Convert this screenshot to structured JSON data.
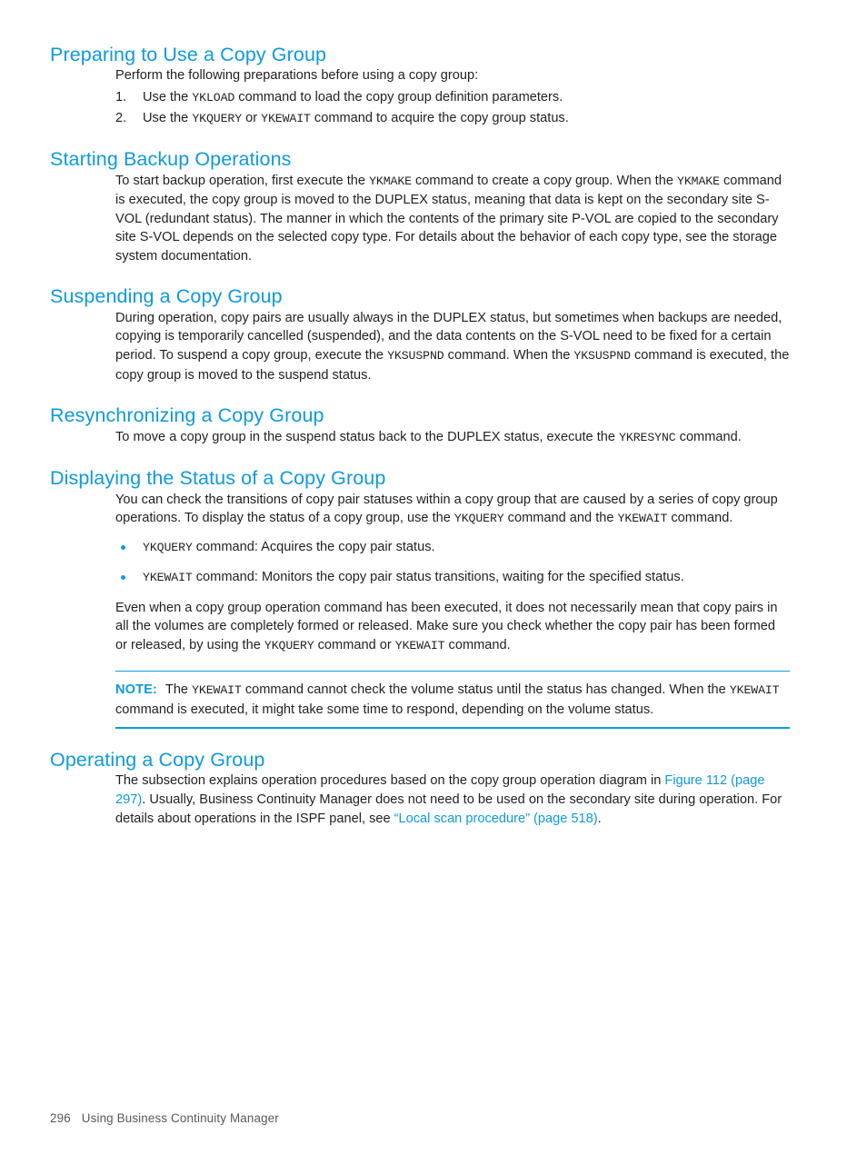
{
  "page": {
    "number": "296",
    "running_title": "Using Business Continuity Manager",
    "accent_color": "#0e9ade",
    "text_color": "#231f20",
    "footer_color": "#58595b"
  },
  "sections": [
    {
      "id": "preparing",
      "heading": "Preparing to Use a Copy Group",
      "intro": "Perform the following preparations before using a copy group:",
      "list": [
        {
          "number": "1.",
          "parts": [
            {
              "t": "text",
              "v": "Use the "
            },
            {
              "t": "code",
              "v": "YKLOAD"
            },
            {
              "t": "text",
              "v": " command to load the copy group definition parameters."
            }
          ]
        },
        {
          "number": "2.",
          "parts": [
            {
              "t": "text",
              "v": "Use the "
            },
            {
              "t": "code",
              "v": "YKQUERY"
            },
            {
              "t": "text",
              "v": " or "
            },
            {
              "t": "code",
              "v": "YKEWAIT"
            },
            {
              "t": "text",
              "v": " command to acquire the copy group status."
            }
          ]
        }
      ]
    },
    {
      "id": "starting-backup",
      "heading": "Starting Backup Operations",
      "paragraph_parts": [
        {
          "t": "text",
          "v": "To start backup operation, first execute the "
        },
        {
          "t": "code",
          "v": "YKMAKE"
        },
        {
          "t": "text",
          "v": " command to create a copy group. When the "
        },
        {
          "t": "code",
          "v": "YKMAKE"
        },
        {
          "t": "text",
          "v": " command is executed, the copy group is moved to the DUPLEX status, meaning that data is kept on the secondary site S-VOL (redundant status). The manner in which the contents of the primary site P-VOL are copied to the secondary site S-VOL depends on the selected copy type. For details about the behavior of each copy type, see the storage system documentation."
        }
      ]
    },
    {
      "id": "suspending",
      "heading": "Suspending a Copy Group",
      "paragraph_parts": [
        {
          "t": "text",
          "v": "During operation, copy pairs are usually always in the DUPLEX status, but sometimes when backups are needed, copying is temporarily cancelled (suspended), and the data contents on the S-VOL need to be fixed for a certain period. To suspend a copy group, execute the "
        },
        {
          "t": "code",
          "v": "YKSUSPND"
        },
        {
          "t": "text",
          "v": " command. When the "
        },
        {
          "t": "code",
          "v": "YKSUSPND"
        },
        {
          "t": "text",
          "v": " command is executed, the copy group is moved to the suspend status."
        }
      ]
    },
    {
      "id": "resynchronizing",
      "heading": "Resynchronizing a Copy Group",
      "paragraph_parts": [
        {
          "t": "text",
          "v": "To move a copy group in the suspend status back to the DUPLEX status, execute the "
        },
        {
          "t": "code",
          "v": "YKRESYNC"
        },
        {
          "t": "text",
          "v": " command."
        }
      ]
    },
    {
      "id": "displaying-status",
      "heading": "Displaying the Status of a Copy Group",
      "paragraph_parts": [
        {
          "t": "text",
          "v": "You can check the transitions of copy pair statuses within a copy group that are caused by a series of copy group operations. To display the status of a copy group, use the "
        },
        {
          "t": "code",
          "v": "YKQUERY"
        },
        {
          "t": "text",
          "v": " command and the "
        },
        {
          "t": "code",
          "v": "YKEWAIT"
        },
        {
          "t": "text",
          "v": " command."
        }
      ],
      "bullets": [
        [
          {
            "t": "code",
            "v": "YKQUERY"
          },
          {
            "t": "text",
            "v": " command: Acquires the copy pair status."
          }
        ],
        [
          {
            "t": "code",
            "v": "YKEWAIT"
          },
          {
            "t": "text",
            "v": " command: Monitors the copy pair status transitions, waiting for the specified status."
          }
        ]
      ],
      "paragraph2_parts": [
        {
          "t": "text",
          "v": "Even when a copy group operation command has been executed, it does not necessarily mean that copy pairs in all the volumes are completely formed or released. Make sure you check whether the copy pair has been formed or released, by using the "
        },
        {
          "t": "code",
          "v": "YKQUERY"
        },
        {
          "t": "text",
          "v": " command or "
        },
        {
          "t": "code",
          "v": "YKEWAIT"
        },
        {
          "t": "text",
          "v": " command."
        }
      ],
      "note": {
        "label": "NOTE:",
        "parts": [
          {
            "t": "text",
            "v": "The "
          },
          {
            "t": "code",
            "v": "YKEWAIT"
          },
          {
            "t": "text",
            "v": " command cannot check the volume status until the status has changed. When the "
          },
          {
            "t": "code",
            "v": "YKEWAIT"
          },
          {
            "t": "text",
            "v": " command is executed, it might take some time to respond, depending on the volume status."
          }
        ]
      }
    },
    {
      "id": "operating",
      "heading": "Operating a Copy Group",
      "paragraph_parts": [
        {
          "t": "text",
          "v": "The subsection explains operation procedures based on the copy group operation diagram in "
        },
        {
          "t": "link",
          "v": "Figure 112 (page 297)"
        },
        {
          "t": "text",
          "v": ". Usually, Business Continuity Manager does not need to be used on the secondary site during operation. For details about operations in the ISPF panel, see "
        },
        {
          "t": "link",
          "v": "“Local scan procedure” (page 518)"
        },
        {
          "t": "text",
          "v": "."
        }
      ]
    }
  ]
}
